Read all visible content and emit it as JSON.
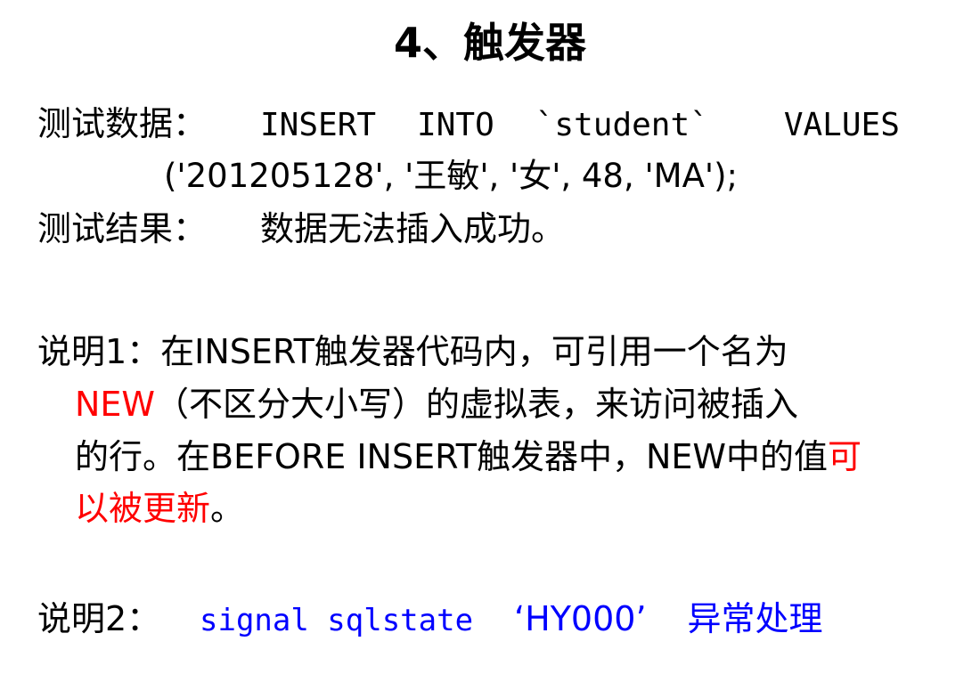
{
  "title": "4、触发器",
  "test_data": {
    "label": "测试数据：",
    "insert": "INSERT",
    "into": "INTO",
    "table": "`student`",
    "values_kw": "VALUES",
    "values_tuple": "('201205128', '王敏', '女', 48, 'MA');"
  },
  "test_result": {
    "label": "测试结果：",
    "text": "数据无法插入成功。"
  },
  "note1": {
    "prefix": "说明1：在INSERT触发器代码内，可引用一个名为",
    "new_keyword": "NEW",
    "line2_rest": "（不区分大小写）的虚拟表，来访问被插入",
    "line3_text": "的行。在BEFORE INSERT触发器中，NEW中的值",
    "line3_highlight": "可",
    "line4_highlight": "以被更新",
    "line4_tail": "。"
  },
  "note2": {
    "label": "说明2：",
    "code": "signal sqlstate",
    "state": "‘HY000’",
    "text": "异常处理"
  },
  "colors": {
    "highlight_red": "#ff0000",
    "highlight_blue": "#0000ff",
    "text": "#000000",
    "background": "#ffffff"
  }
}
